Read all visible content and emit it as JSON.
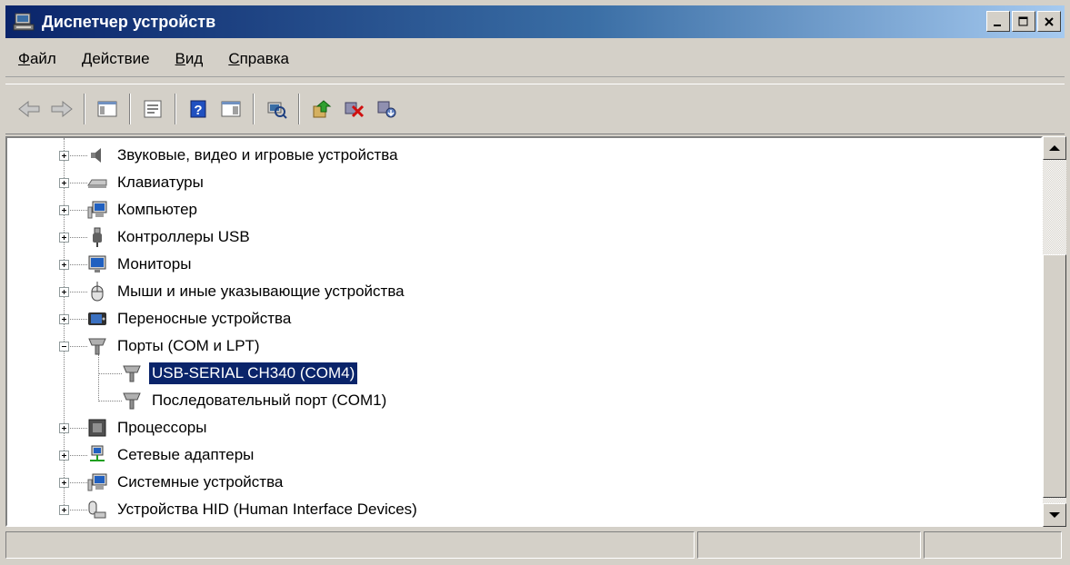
{
  "window": {
    "title": "Диспетчер устройств"
  },
  "title_buttons": {
    "minimize": "_",
    "maximize": "□",
    "close": "✕"
  },
  "menu": [
    "Файл",
    "Действие",
    "Вид",
    "Справка"
  ],
  "toolbar": {
    "buttons": [
      "back-icon",
      "forward-icon",
      "show-hide-tree-icon",
      "properties-icon",
      "help-icon",
      "action-pane-icon",
      "scan-hardware-icon",
      "update-driver-icon",
      "disable-device-icon",
      "uninstall-device-icon"
    ]
  },
  "tree": {
    "items": [
      {
        "label": "Звуковые, видео и игровые устройства",
        "icon": "sound-icon",
        "expanded": false
      },
      {
        "label": "Клавиатуры",
        "icon": "keyboard-icon",
        "expanded": false
      },
      {
        "label": "Компьютер",
        "icon": "computer-icon",
        "expanded": false
      },
      {
        "label": "Контроллеры USB",
        "icon": "usb-icon",
        "expanded": false
      },
      {
        "label": "Мониторы",
        "icon": "monitor-icon",
        "expanded": false
      },
      {
        "label": "Мыши и иные указывающие устройства",
        "icon": "mouse-icon",
        "expanded": false
      },
      {
        "label": "Переносные устройства",
        "icon": "portable-device-icon",
        "expanded": false
      },
      {
        "label": "Порты (COM и LPT)",
        "icon": "port-icon",
        "expanded": true,
        "children": [
          {
            "label": "USB-SERIAL CH340 (COM4)",
            "icon": "port-icon",
            "selected": true
          },
          {
            "label": "Последовательный порт (COM1)",
            "icon": "port-icon",
            "selected": false
          }
        ]
      },
      {
        "label": "Процессоры",
        "icon": "processor-icon",
        "expanded": false
      },
      {
        "label": "Сетевые адаптеры",
        "icon": "network-adapter-icon",
        "expanded": false
      },
      {
        "label": "Системные устройства",
        "icon": "system-devices-icon",
        "expanded": false
      },
      {
        "label": "Устройства HID (Human Interface Devices)",
        "icon": "hid-icon",
        "expanded": false
      }
    ]
  },
  "status_bar": {
    "panes": [
      "",
      "",
      ""
    ]
  }
}
